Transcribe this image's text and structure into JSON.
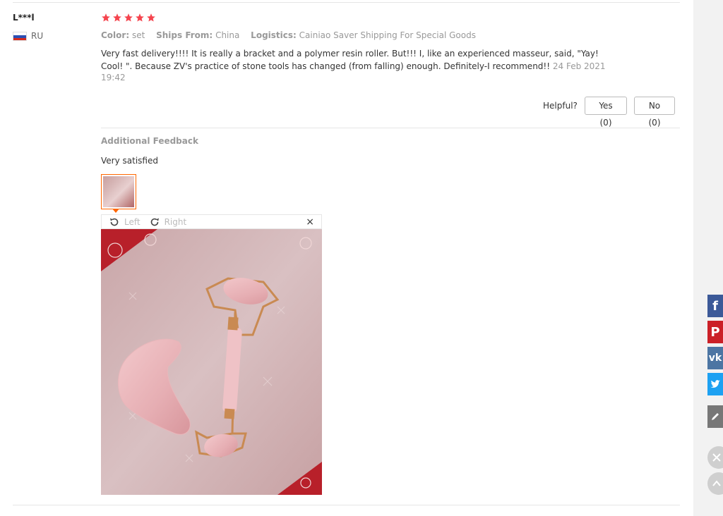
{
  "reviewer": {
    "name": "L***l",
    "country_code": "RU"
  },
  "rating": {
    "stars": 5,
    "max": 5,
    "color": "#f5444e"
  },
  "meta": {
    "color_label": "Color:",
    "color_value": "set",
    "ships_from_label": "Ships From:",
    "ships_from_value": "China",
    "logistics_label": "Logistics:",
    "logistics_value": "Cainiao Saver Shipping For Special Goods"
  },
  "review": {
    "text": "Very fast delivery!!!! It is really a bracket and a polymer resin roller. But!!! I, like an experienced masseur, said, \"Yay! Cool! \". Because ZV's practice of stone tools has changed (from falling) enough. Definitely-I recommend!!",
    "date": "24 Feb 2021",
    "time": "19:42"
  },
  "helpful": {
    "label": "Helpful?",
    "yes_label": "Yes (0)",
    "no_label": "No (0)"
  },
  "additional_feedback": {
    "title": "Additional Feedback",
    "text": "Very satisfied"
  },
  "viewer": {
    "rotate_left_label": "Left",
    "rotate_right_label": "Right",
    "close_symbol": "×"
  },
  "sidebar_share": [
    {
      "name": "facebook",
      "glyph": "f",
      "color": "#3b5998"
    },
    {
      "name": "pinterest",
      "glyph": "P",
      "color": "#cb2027"
    },
    {
      "name": "vk",
      "glyph": "vk",
      "color": "#4c75a3"
    },
    {
      "name": "twitter",
      "glyph": "t",
      "color": "#1da1f2"
    }
  ]
}
